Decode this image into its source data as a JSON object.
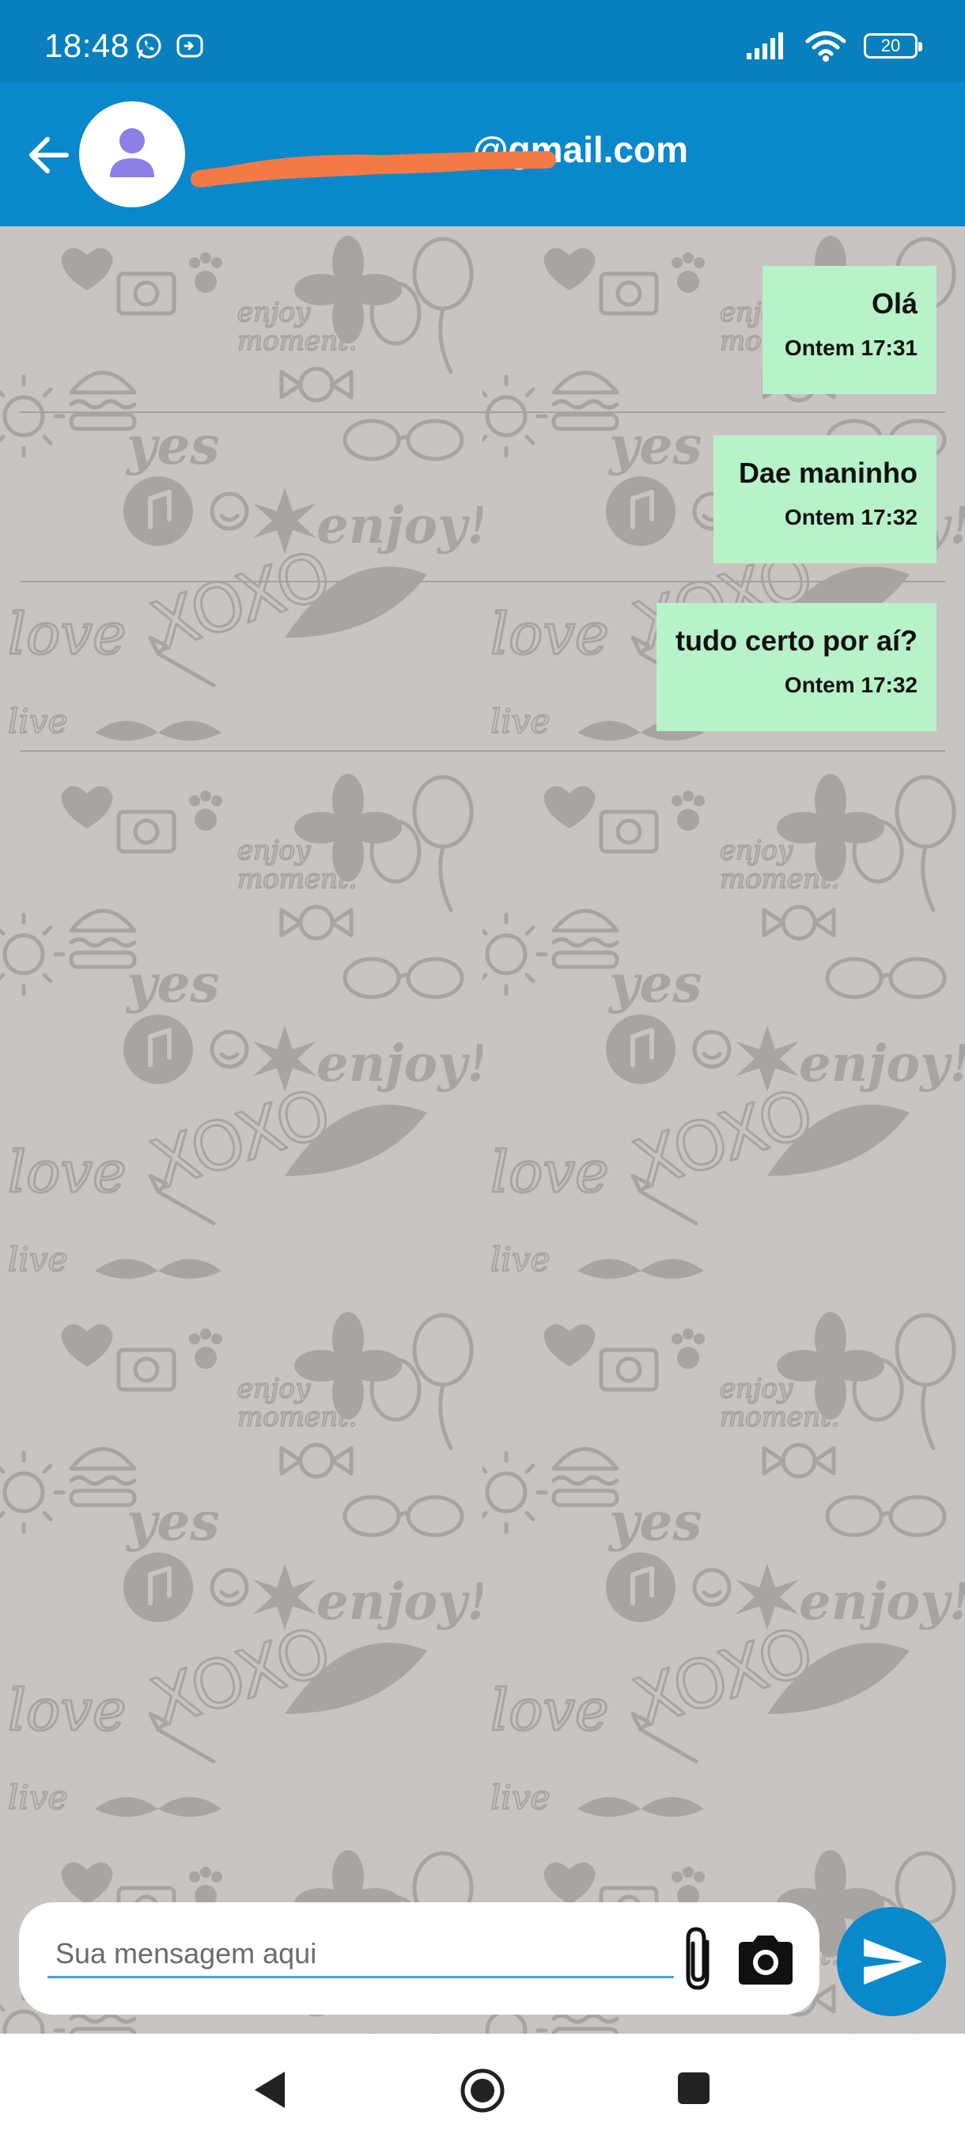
{
  "status_bar": {
    "time": "18:48",
    "battery": "20",
    "icons": [
      "whatsapp-icon",
      "screen-record-icon",
      "signal-icon",
      "wifi-icon",
      "battery-icon"
    ]
  },
  "app_bar": {
    "contact_name_visible": "@gmail.com",
    "icons": [
      "back-arrow-icon",
      "person-icon"
    ]
  },
  "messages": [
    {
      "text": "Olá",
      "time": "Ontem 17:31"
    },
    {
      "text": "Dae maninho",
      "time": "Ontem 17:32"
    },
    {
      "text": "tudo certo por aí?",
      "time": "Ontem 17:32"
    }
  ],
  "input": {
    "placeholder": "Sua mensagem aqui",
    "value": ""
  },
  "nav": {
    "icons": [
      "nav-back-icon",
      "nav-home-icon",
      "nav-recents-icon"
    ]
  },
  "colors": {
    "header": "#0a88cc",
    "status_bar": "#0a7fbe",
    "bubble": "#b8f2c8",
    "chat_background": "#c8c4c1",
    "redaction": "#f47a45",
    "avatar_icon": "#8c7fe8"
  }
}
